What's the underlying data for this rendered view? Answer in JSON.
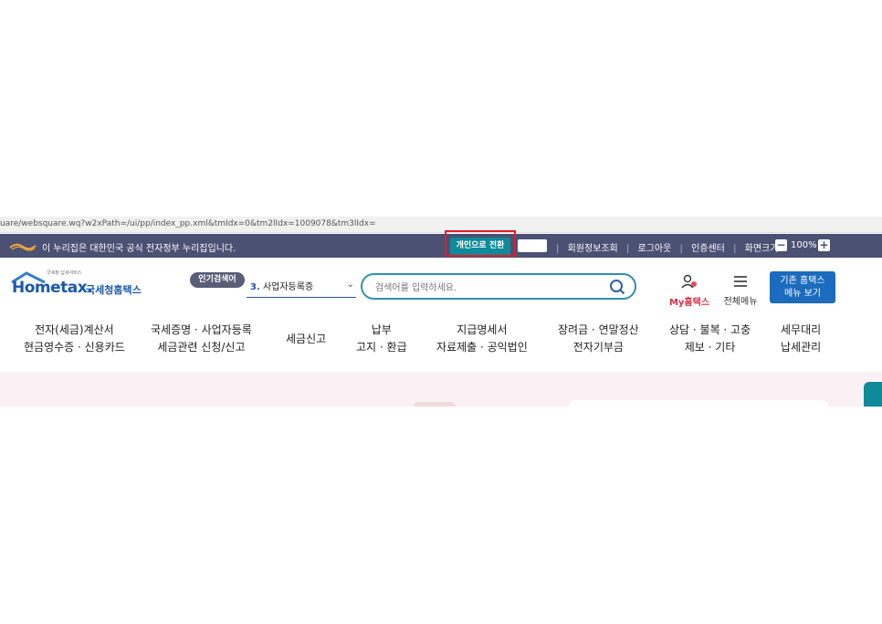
{
  "browser": {
    "url": "uare/websquare.wq?w2xPath=/ui/pp/index_pp.xml&tmIdx=0&tm2lIdx=1009078&tm3lIdx="
  },
  "topbar": {
    "gov_notice": "이 누리집은 대한민국 공식 전자정부 누리집입니다.",
    "switch_label": "개인으로 전환",
    "links": [
      "회원정보조회",
      "로그아웃",
      "인증센터",
      "화면크기"
    ],
    "zoom_minus": "−",
    "zoom_level": "100%",
    "zoom_plus": "+"
  },
  "header": {
    "logo_tagline": "국세청 납세서비스",
    "logo_en": "Hometax.",
    "logo_ko": "국세청홈택스",
    "popular_tag": "인기검색어",
    "popular_rank": "3.",
    "popular_term": "사업자등록증",
    "search_placeholder": "검색어를 입력하세요.",
    "my_hometax": "My홈택스",
    "all_menu": "전체메뉴",
    "legacy_line1": "기존 홈택스",
    "legacy_line2": "메뉴 보기"
  },
  "gnb": [
    {
      "line1": "전자(세금)계산서",
      "line2": "현금영수증 · 신용카드"
    },
    {
      "line1": "국세증명 · 사업자등록",
      "line2": "세금관련 신청/신고"
    },
    {
      "line1": "세금신고",
      "line2": ""
    },
    {
      "line1": "납부",
      "line2": "고지 · 환급"
    },
    {
      "line1": "지급명세서",
      "line2": "자료제출 · 공익법인"
    },
    {
      "line1": "장려금 · 연말정산",
      "line2": "전자기부금"
    },
    {
      "line1": "상담 · 불복 · 고충",
      "line2": "제보 · 기타"
    },
    {
      "line1": "세무대리",
      "line2": "납세관리"
    }
  ],
  "colors": {
    "topbar_bg": "#4a5173",
    "switch_btn": "#0f8a99",
    "highlight": "#e21b2a",
    "brand_blue": "#1b5aa8",
    "search_border": "#2f8fb1"
  }
}
